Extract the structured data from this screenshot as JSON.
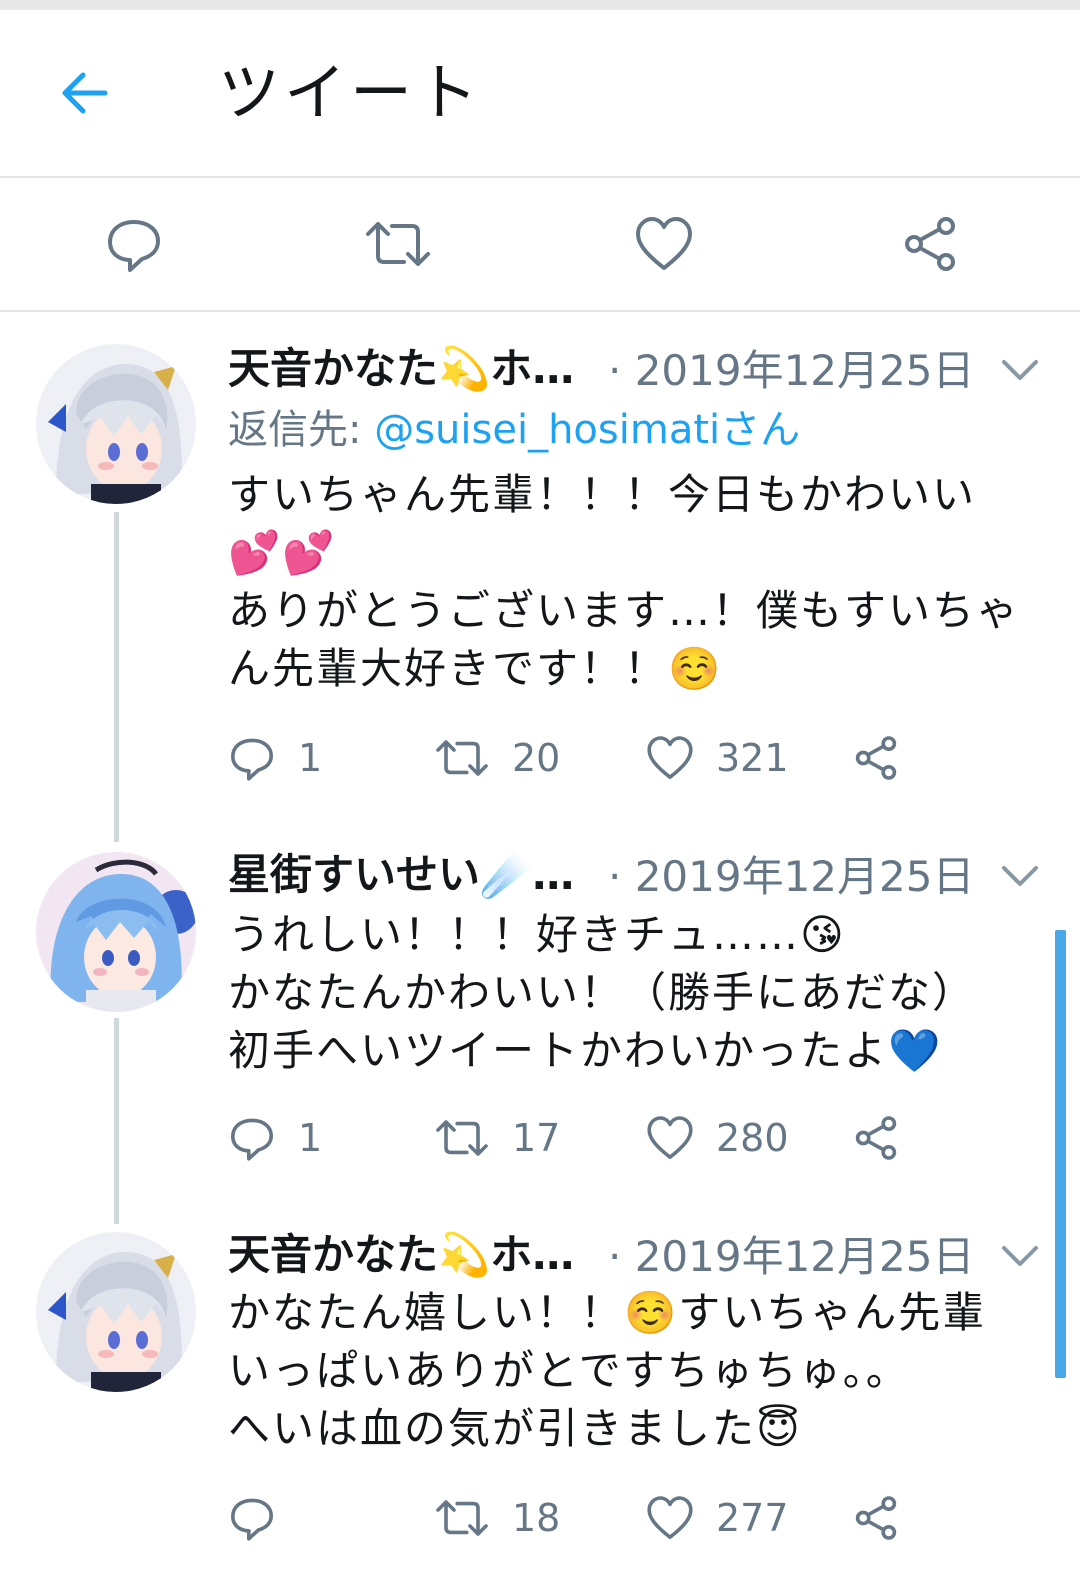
{
  "header": {
    "title": "ツイート",
    "back_icon": "arrow-left-icon"
  },
  "action_bar": {
    "icons": [
      "reply-icon",
      "retweet-icon",
      "like-icon",
      "share-icon"
    ]
  },
  "colors": {
    "accent": "#1da1f2",
    "muted": "#657786",
    "text": "#14171a",
    "divider": "#e1e8ed",
    "thread_line": "#cfd9de"
  },
  "tweets": [
    {
      "name": "天音かなた💫ホ…",
      "date": "· 2019年12月25日",
      "reply_to_label": "返信先: ",
      "reply_to_handle": "@suisei_hosimatiさん",
      "body": "すいちゃん先輩！！！今日もかわいい💕💕\nありがとうございます…！僕もすいちゃん先輩大好きです！！☺️",
      "replies": "1",
      "retweets": "20",
      "likes": "321"
    },
    {
      "name": "星街すいせい☄️…",
      "date": "· 2019年12月25日",
      "body": "うれしい！！！好きチュ……😘\nかなたんかわいい！（勝手にあだな）\n初手へいツイートかわいかったよ💙",
      "replies": "1",
      "retweets": "17",
      "likes": "280"
    },
    {
      "name": "天音かなた💫ホ…",
      "date": "· 2019年12月25日",
      "body": "かなたん嬉しい！！☺️すいちゃん先輩いっぱいありがとですちゅちゅ。。\nへいは血の気が引きました😇",
      "replies": "",
      "retweets": "18",
      "likes": "277"
    }
  ]
}
